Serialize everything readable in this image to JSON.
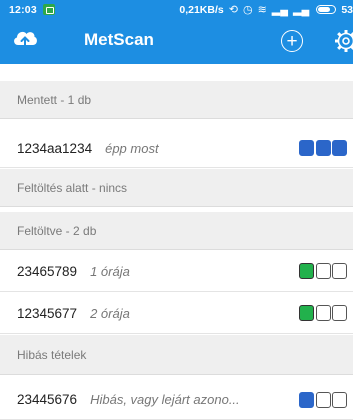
{
  "status_bar": {
    "time": "12:03",
    "speed": "0,21KB/s",
    "battery": "53"
  },
  "app_bar": {
    "title": "MetScan",
    "add_symbol": "+"
  },
  "sections": [
    {
      "label": "Mentett - 1 db"
    },
    {
      "label": "Feltöltés alatt - nincs"
    },
    {
      "label": "Feltöltve - 2 db"
    },
    {
      "label": "Hibás tételek"
    }
  ],
  "rows": [
    {
      "code": "1234aa1234",
      "time": "épp most",
      "boxes": [
        "blue",
        "blue",
        "blue"
      ]
    },
    {
      "code": "23465789",
      "time": "1 órája",
      "boxes": [
        "green",
        "empty",
        "empty"
      ]
    },
    {
      "code": "12345677",
      "time": "2 órája",
      "boxes": [
        "green",
        "empty",
        "empty"
      ]
    },
    {
      "code": "23445676",
      "time": "Hibás, vagy lejárt azono...",
      "boxes": [
        "blue",
        "empty",
        "empty"
      ]
    }
  ],
  "colors": {
    "primary": "#1d8ee2",
    "box_blue": "#2b66c9",
    "box_green": "#22b14c",
    "section_bg": "#efefef"
  },
  "icons": {
    "logo": "cloud-upload-icon",
    "add": "add-circle-icon",
    "settings": "gear-icon"
  }
}
